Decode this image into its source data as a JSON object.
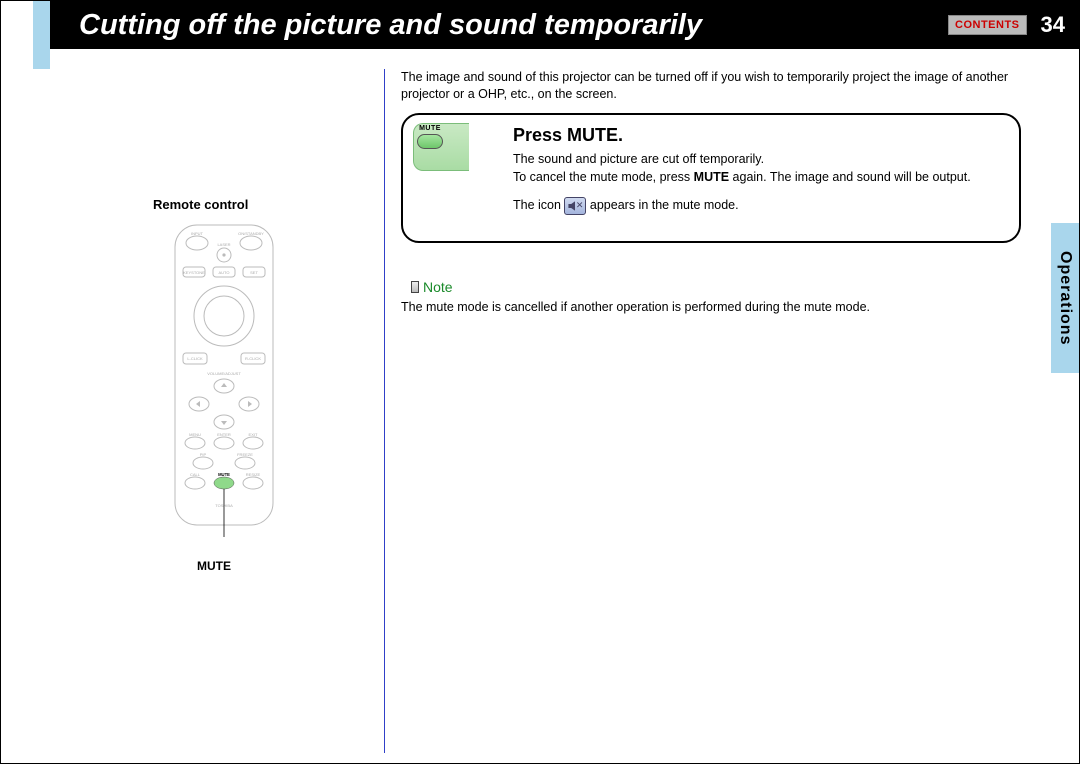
{
  "header": {
    "title": "Cutting off the picture and sound temporarily",
    "contents_label": "CONTENTS",
    "page_number": "34"
  },
  "side_tab": "Operations",
  "left_panel": {
    "remote_label": "Remote control",
    "mute_label": "MUTE",
    "brand": "TOSHIBA",
    "buttons": {
      "input": "INPUT",
      "on_standby": "ON/STANDBY",
      "laser": "LASER",
      "keystone": "KEYSTONE",
      "auto": "AUTO",
      "set": "SET",
      "l_click": "L-CLICK",
      "r_click": "R-CLICK",
      "vol_center": "VOLUME/ADJUST",
      "menu": "MENU",
      "enter": "ENTER",
      "exit": "EXIT",
      "pip": "PIP",
      "freeze": "FREEZE",
      "call": "CALL",
      "mute_small": "MUTE",
      "resize": "RESIZE"
    }
  },
  "intro": "The image and sound of this projector can be turned off if you wish to temporarily project the image of another projector or a OHP, etc., on the screen.",
  "instruction": {
    "key_label": "MUTE",
    "title": "Press MUTE.",
    "line1": "The sound and picture are cut off temporarily.",
    "line2_a": "To cancel the mute mode, press ",
    "line2_bold": "MUTE",
    "line2_b": " again. The image and sound will be output.",
    "line3_a": "The icon ",
    "line3_b": " appears in the mute mode."
  },
  "note": {
    "label": "Note",
    "body": "The mute mode is cancelled if another operation is performed during the mute mode."
  }
}
